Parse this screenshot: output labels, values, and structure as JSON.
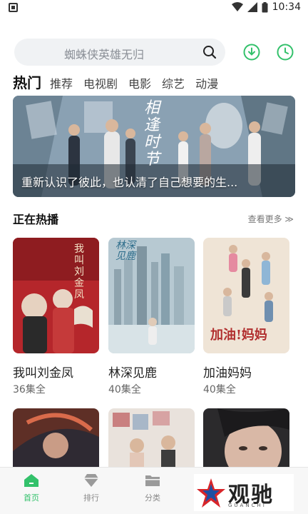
{
  "status_bar": {
    "time": "10:34"
  },
  "search": {
    "placeholder": "蜘蛛侠英雄无归"
  },
  "tabs": [
    {
      "label": "热门",
      "active": true
    },
    {
      "label": "推荐"
    },
    {
      "label": "电视剧"
    },
    {
      "label": "电影"
    },
    {
      "label": "综艺"
    },
    {
      "label": "动漫"
    }
  ],
  "banner": {
    "caption": "重新认识了彼此，也认清了自己想要的生...",
    "logo_text": "相逢时节"
  },
  "section": {
    "title": "正在热播",
    "more": "查看更多 ≫"
  },
  "cards": [
    {
      "title": "我叫刘金凤",
      "episodes": "36集全",
      "poster_text": "我叫刘金凤"
    },
    {
      "title": "林深见鹿",
      "episodes": "40集全",
      "poster_text": "林深见鹿"
    },
    {
      "title": "加油妈妈",
      "episodes": "40集全",
      "poster_text": "加油!妈妈"
    }
  ],
  "bottom_nav": [
    {
      "label": "首页",
      "icon": "home-icon",
      "active": true
    },
    {
      "label": "排行",
      "icon": "diamond-icon"
    },
    {
      "label": "分类",
      "icon": "folder-icon"
    }
  ],
  "watermark": {
    "text": "观驰",
    "sub": "GUANCHI"
  },
  "colors": {
    "accent": "#33c16b",
    "search_bg": "#f0f2f4"
  }
}
